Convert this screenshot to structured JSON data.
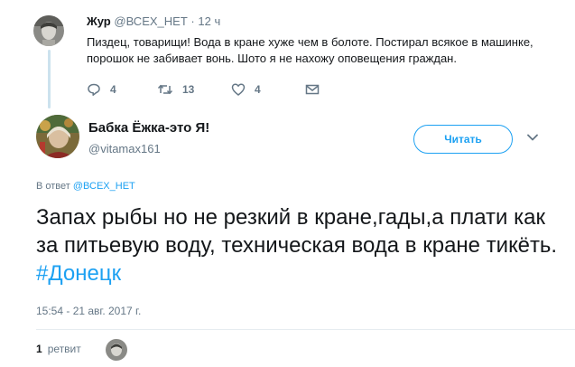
{
  "parent_tweet": {
    "name": "Жур",
    "handle": "@ВСЕХ_НЕТ",
    "separator": "·",
    "time": "12 ч",
    "text": "Пиздец, товарищи! Вода в кране хуже чем в болоте. Постирал всякое в машинке, порошок не забивает вонь. Шото я не нахожу оповещения граждан.",
    "actions": {
      "replies": "4",
      "retweets": "13",
      "likes": "4"
    }
  },
  "main_tweet": {
    "name": "Бабка Ёжка-это Я!",
    "handle": "@vitamax161",
    "follow_label": "Читать",
    "reply_prefix": "В ответ",
    "reply_handle": "@ВСЕХ_НЕТ",
    "text": "Запах рыбы но не резкий в кране,гады,а плати как за питьевую воду, техническая вода в кране тикёть.",
    "hashtag": "#Донецк",
    "timestamp": "15:54 - 21 авг. 2017 г.",
    "retweet_count": "1",
    "retweet_label": "ретвит"
  },
  "colors": {
    "accent": "#1da1f2",
    "muted": "#657786",
    "text": "#14171a",
    "thread_line": "#cce2ee"
  }
}
